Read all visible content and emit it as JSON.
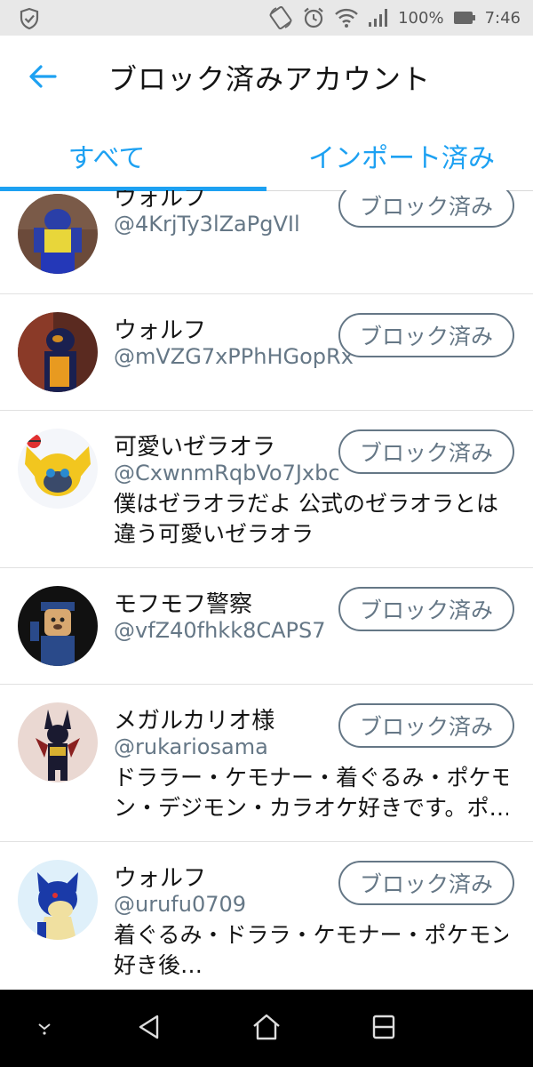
{
  "status_bar": {
    "battery_percent": "100%",
    "time": "7:46",
    "icons": [
      "shield-icon",
      "rotate-icon",
      "alarm-icon",
      "wifi-icon",
      "signal-icon",
      "battery-icon"
    ]
  },
  "header": {
    "title": "ブロック済みアカウント",
    "back_icon": "arrow-left-icon"
  },
  "tabs": [
    {
      "label": "すべて",
      "active": true
    },
    {
      "label": "インポート済み",
      "active": false
    }
  ],
  "colors": {
    "accent": "#1da1f2",
    "secondary_text": "#657786",
    "primary_text": "#141414",
    "divider": "#e1e1e1"
  },
  "accounts": [
    {
      "name": "ウォルフ",
      "handle": "@4KrjTy3lZaPgVIl",
      "bio": [],
      "button": "ブロック済み"
    },
    {
      "name": "ウォルフ",
      "handle": "@mVZG7xPPhHGopRx",
      "bio": [],
      "button": "ブロック済み"
    },
    {
      "name": "可愛いゼラオラ",
      "handle": "@CxwnmRqbVo7Jxbc",
      "bio": [
        "僕はゼラオラだよ 公式のゼラオラとは",
        "違う可愛いゼラオラ"
      ],
      "button": "ブロック済み"
    },
    {
      "name": "モフモフ警察",
      "handle": "@vfZ40fhkk8CAPS7",
      "bio": [],
      "button": "ブロック済み"
    },
    {
      "name": "メガルカリオ様",
      "handle": "@rukariosama",
      "bio": [
        "ドララー・ケモナー・着ぐるみ・ポケモ",
        "ン・デジモン・カラオケ好きです。ポ…"
      ],
      "button": "ブロック済み"
    },
    {
      "name": "ウォルフ",
      "handle": "@urufu0709",
      "bio": [
        "着ぐるみ・ドララ・ケモナー・ポケモン",
        "好き後…"
      ],
      "button": "ブロック済み"
    }
  ],
  "nav_bar": {
    "icons": [
      "chevron-down-icon",
      "back-triangle-icon",
      "home-icon",
      "recents-icon"
    ]
  }
}
